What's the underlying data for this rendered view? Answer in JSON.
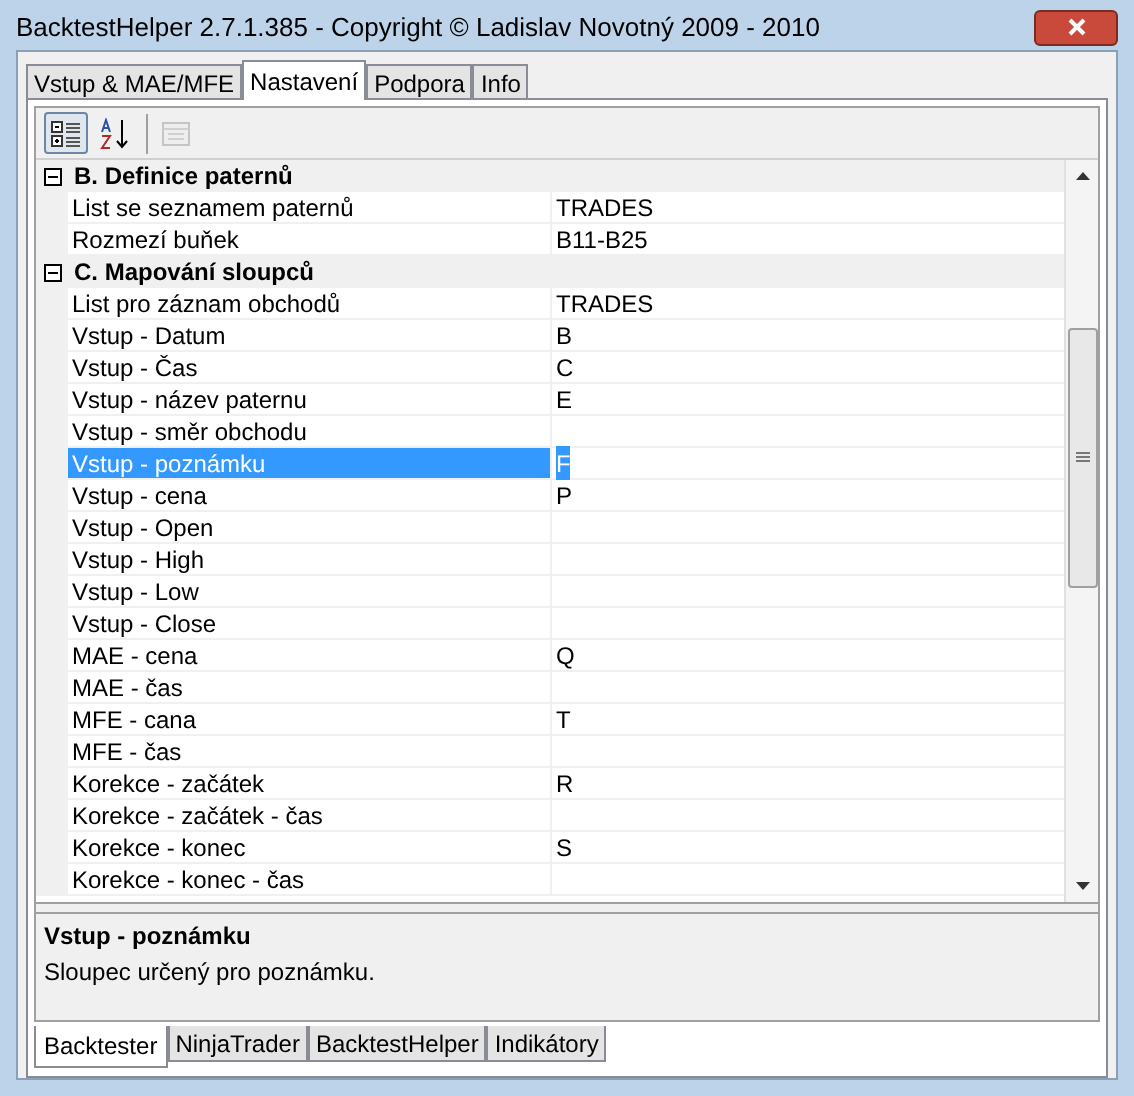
{
  "window": {
    "title": "BacktestHelper 2.7.1.385 - Copyright © Ladislav Novotný 2009 - 2010"
  },
  "tabs": [
    {
      "label": "Vstup & MAE/MFE",
      "selected": false
    },
    {
      "label": "Nastavení",
      "selected": true
    },
    {
      "label": "Podpora",
      "selected": false
    },
    {
      "label": "Info",
      "selected": false
    }
  ],
  "toolbar": [
    {
      "kind": "categorized",
      "selected": true,
      "disabled": false
    },
    {
      "kind": "alphabetical",
      "selected": false,
      "disabled": false
    },
    {
      "kind": "pages",
      "selected": false,
      "disabled": true
    }
  ],
  "grid": {
    "categories": [
      {
        "title": "B. Definice paternů",
        "expanded": true,
        "rows": [
          {
            "label": "List se seznamem paternů",
            "value": "TRADES",
            "selected": false
          },
          {
            "label": "Rozmezí buňek",
            "value": "B11-B25",
            "selected": false
          }
        ]
      },
      {
        "title": "C. Mapování sloupců",
        "expanded": true,
        "rows": [
          {
            "label": "List pro záznam obchodů",
            "value": "TRADES",
            "selected": false
          },
          {
            "label": "Vstup - Datum",
            "value": "B",
            "selected": false
          },
          {
            "label": "Vstup - Čas",
            "value": "C",
            "selected": false
          },
          {
            "label": "Vstup - název paternu",
            "value": "E",
            "selected": false
          },
          {
            "label": "Vstup - směr obchodu",
            "selected": false
          },
          {
            "label": "Vstup - poznámku",
            "value": "F",
            "selected": true
          },
          {
            "label": "Vstup - cena",
            "value": "P",
            "selected": false
          },
          {
            "label": "Vstup - Open",
            "selected": false
          },
          {
            "label": "Vstup - High",
            "selected": false
          },
          {
            "label": "Vstup - Low",
            "selected": false
          },
          {
            "label": "Vstup - Close",
            "selected": false
          },
          {
            "label": "MAE - cena",
            "value": "Q",
            "selected": false
          },
          {
            "label": "MAE - čas",
            "selected": false
          },
          {
            "label": "MFE - cana",
            "value": "T",
            "selected": false
          },
          {
            "label": "MFE - čas",
            "selected": false
          },
          {
            "label": "Korekce - začátek",
            "value": "R",
            "selected": false
          },
          {
            "label": "Korekce - začátek - čas",
            "selected": false
          },
          {
            "label": "Korekce - konec",
            "value": "S",
            "selected": false
          },
          {
            "label": "Korekce - konec - čas",
            "selected": false
          }
        ]
      }
    ]
  },
  "description": {
    "title": "Vstup - poznámku",
    "text": "Sloupec určený pro poznámku."
  },
  "bottom_tabs": [
    {
      "label": "Backtester",
      "selected": true
    },
    {
      "label": "NinjaTrader",
      "selected": false
    },
    {
      "label": "BacktestHelper",
      "selected": false
    },
    {
      "label": "Indikátory",
      "selected": false
    }
  ]
}
